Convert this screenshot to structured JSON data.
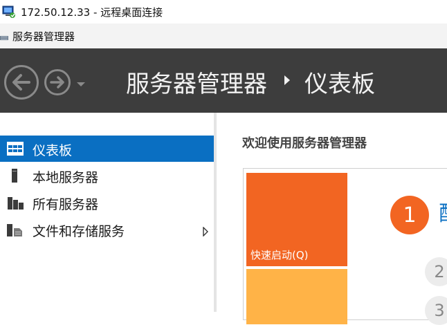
{
  "rdp_window": {
    "title": "172.50.12.33 - 远程桌面连接",
    "icon": "remote-desktop-icon"
  },
  "app_window": {
    "title": "服务器管理器",
    "icon": "server-manager-icon"
  },
  "header": {
    "breadcrumb_root": "服务器管理器",
    "breadcrumb_current": "仪表板",
    "back_icon": "back-arrow-icon",
    "forward_icon": "forward-arrow-icon",
    "history_icon": "chevron-down-icon",
    "separator_icon": "triangle-right-icon",
    "background": "#3d3d3d"
  },
  "sidebar": {
    "items": [
      {
        "label": "仪表板",
        "icon": "dashboard-icon",
        "selected": true
      },
      {
        "label": "本地服务器",
        "icon": "local-server-icon",
        "selected": false
      },
      {
        "label": "所有服务器",
        "icon": "all-servers-icon",
        "selected": false
      },
      {
        "label": "文件和存储服务",
        "icon": "file-storage-icon",
        "selected": false,
        "has_submenu": true
      }
    ],
    "selected_color": "#0a6fc2"
  },
  "main": {
    "welcome_heading": "欢迎使用服务器管理器",
    "quick_start_label": "快速启动(Q)",
    "step_1_number": "1",
    "step_1_text": "配",
    "step_2_number": "2",
    "step_3_number": "3",
    "accent_orange": "#f26522",
    "accent_light_orange": "#ffb347"
  }
}
